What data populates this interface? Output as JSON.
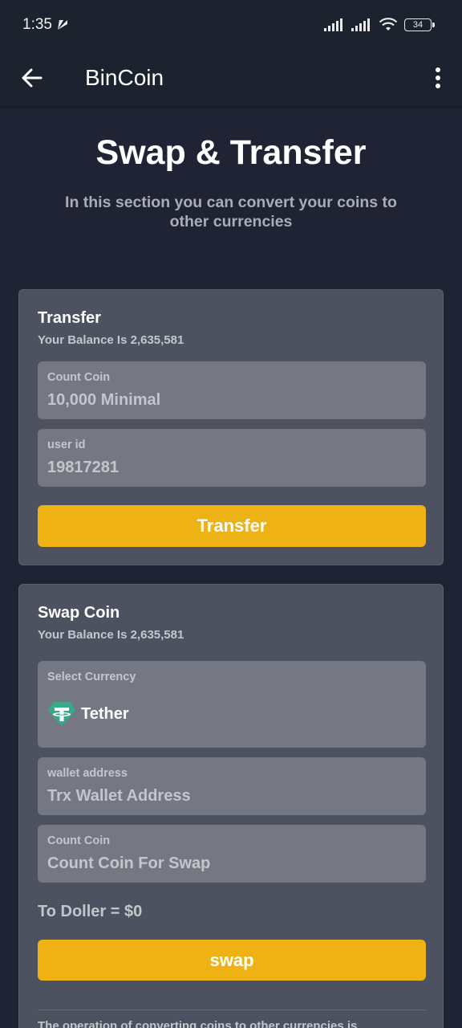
{
  "status_bar": {
    "time": "1:35",
    "battery": "34"
  },
  "app_bar": {
    "title": "BinCoin"
  },
  "hero": {
    "title": "Swap & Transfer",
    "subtitle": "In this section you can convert your coins to other currencies"
  },
  "transfer": {
    "title": "Transfer",
    "balance": "Your Balance Is 2,635,581",
    "count_label": "Count Coin",
    "count_placeholder": "10,000 Minimal",
    "userid_label": "user id",
    "userid_value": "19817281",
    "button_label": "Transfer"
  },
  "swap": {
    "title": "Swap Coin",
    "balance": "Your Balance Is 2,635,581",
    "currency_label": "Select Currency",
    "currency_icon": "tether-icon",
    "currency_value": "Tether",
    "wallet_label": "wallet address",
    "wallet_placeholder": "Trx Wallet Address",
    "count_label": "Count Coin",
    "count_placeholder": "Count Coin For Swap",
    "to_dollar": "To Doller = $0",
    "button_label": "swap",
    "note": "The operation of converting coins to other currencies is"
  },
  "colors": {
    "background": "#1f2333",
    "app_bar": "#1d232e",
    "card": "#4d5260",
    "field": "#757882",
    "accent": "#eeb214",
    "tether": "#3aa98a"
  }
}
